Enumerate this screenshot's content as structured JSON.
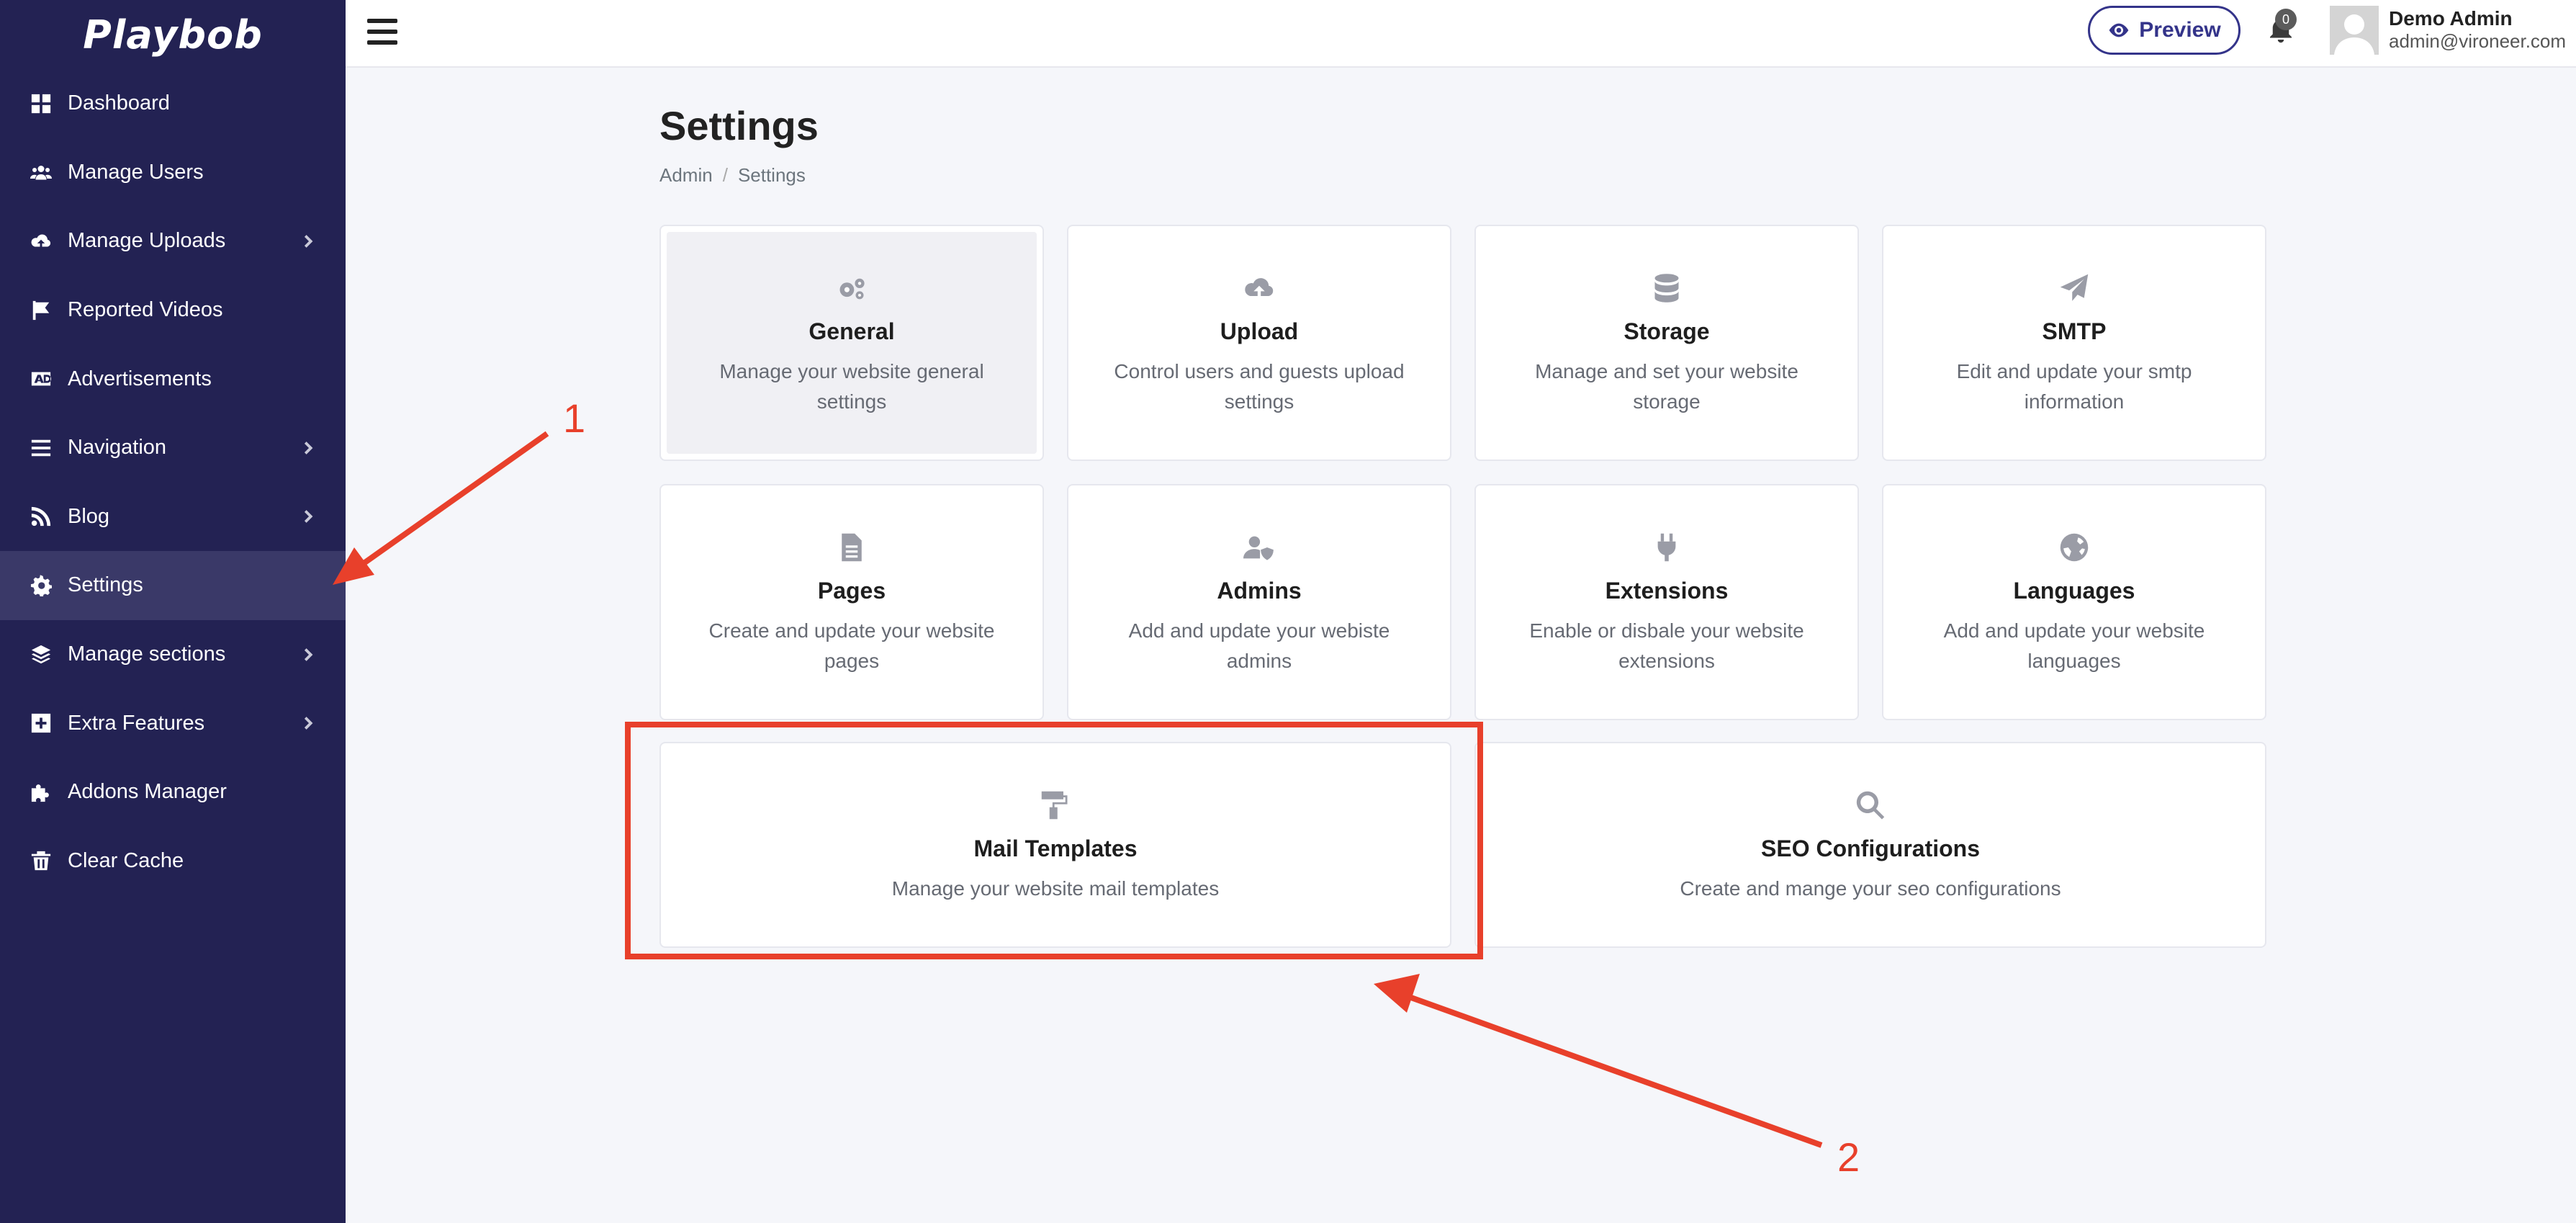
{
  "app": {
    "logo": "Playbob"
  },
  "sidebar": {
    "items": [
      {
        "label": "Dashboard",
        "icon": "dashboard-icon",
        "chevron": false,
        "active": false
      },
      {
        "label": "Manage Users",
        "icon": "users-icon",
        "chevron": false,
        "active": false
      },
      {
        "label": "Manage Uploads",
        "icon": "cloud-upload-icon",
        "chevron": true,
        "active": false
      },
      {
        "label": "Reported Videos",
        "icon": "flag-icon",
        "chevron": false,
        "active": false
      },
      {
        "label": "Advertisements",
        "icon": "ad-icon",
        "chevron": false,
        "active": false
      },
      {
        "label": "Navigation",
        "icon": "bars-icon",
        "chevron": true,
        "active": false
      },
      {
        "label": "Blog",
        "icon": "rss-icon",
        "chevron": true,
        "active": false
      },
      {
        "label": "Settings",
        "icon": "gear-icon",
        "chevron": false,
        "active": true
      },
      {
        "label": "Manage sections",
        "icon": "layers-icon",
        "chevron": true,
        "active": false
      },
      {
        "label": "Extra Features",
        "icon": "plus-square-icon",
        "chevron": true,
        "active": false
      },
      {
        "label": "Addons Manager",
        "icon": "puzzle-icon",
        "chevron": false,
        "active": false
      },
      {
        "label": "Clear Cache",
        "icon": "trash-icon",
        "chevron": false,
        "active": false
      }
    ]
  },
  "topbar": {
    "preview_label": "Preview",
    "notifications_count": "0",
    "user_name": "Demo Admin",
    "user_email": "admin@vironeer.com"
  },
  "page": {
    "title": "Settings",
    "breadcrumb": [
      "Admin",
      "Settings"
    ]
  },
  "cards": [
    {
      "title": "General",
      "desc": "Manage your website general settings",
      "icon": "gears-icon"
    },
    {
      "title": "Upload",
      "desc": "Control users and guests upload settings",
      "icon": "cloud-upload-icon"
    },
    {
      "title": "Storage",
      "desc": "Manage and set your website storage",
      "icon": "database-icon"
    },
    {
      "title": "SMTP",
      "desc": "Edit and update your smtp information",
      "icon": "paper-plane-icon"
    },
    {
      "title": "Pages",
      "desc": "Create and update your website pages",
      "icon": "file-icon"
    },
    {
      "title": "Admins",
      "desc": "Add and update your webiste admins",
      "icon": "user-shield-icon"
    },
    {
      "title": "Extensions",
      "desc": "Enable or disbale your website extensions",
      "icon": "plug-icon"
    },
    {
      "title": "Languages",
      "desc": "Add and update your website languages",
      "icon": "globe-icon"
    },
    {
      "title": "Mail Templates",
      "desc": "Manage your website mail templates",
      "icon": "paint-roller-icon"
    },
    {
      "title": "SEO Configurations",
      "desc": "Create and mange your seo configurations",
      "icon": "search-icon"
    }
  ],
  "annotations": {
    "label_1": "1",
    "label_2": "2",
    "color": "#e8402b"
  }
}
